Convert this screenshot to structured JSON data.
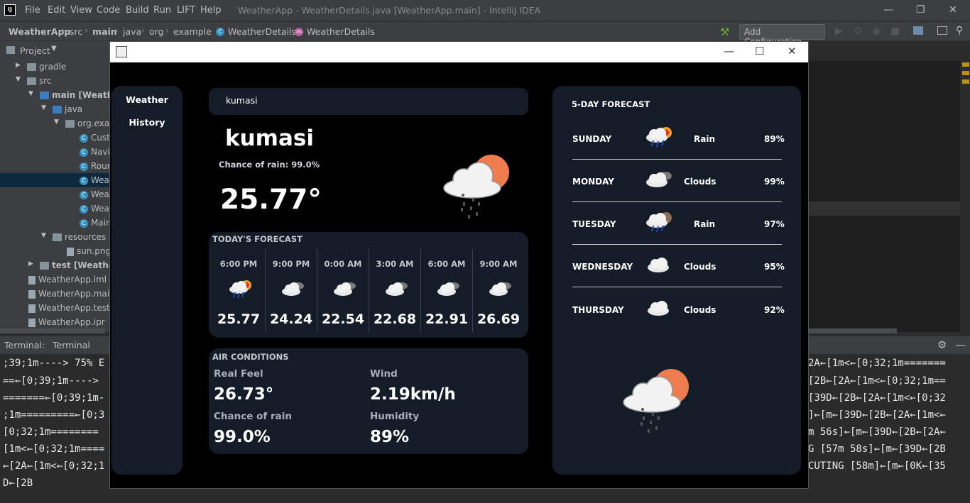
{
  "ide": {
    "logo": "IJ",
    "menu": [
      "File",
      "Edit",
      "View",
      "Code",
      "Build",
      "Run",
      "LIFT",
      "Help"
    ],
    "title": "WeatherApp - WeatherDetails.java [WeatherApp.main] - IntelliJ IDEA",
    "breadcrumbs": [
      "WeatherApp",
      "src",
      "main",
      "java",
      "org",
      "example",
      "WeatherDetails",
      "WeatherDetails"
    ],
    "add_configuration": "Add Configuration...",
    "project_label": "Project",
    "tree": [
      {
        "label": "gradle",
        "icon": "folder-icon"
      },
      {
        "label": "src",
        "icon": "folder-icon"
      },
      {
        "label": "main [Weathe",
        "icon": "folder-icon"
      },
      {
        "label": "java",
        "icon": "folder-icon"
      },
      {
        "label": "org.exan",
        "icon": "package-icon"
      },
      {
        "label": "Cust",
        "icon": "class-icon"
      },
      {
        "label": "Navi",
        "icon": "class-icon"
      },
      {
        "label": "Roun",
        "icon": "class-icon"
      },
      {
        "label": "Weat",
        "icon": "class-icon"
      },
      {
        "label": "Weat",
        "icon": "class-icon"
      },
      {
        "label": "Weat",
        "icon": "class-icon"
      },
      {
        "label": "Main",
        "icon": "class-icon"
      },
      {
        "label": "resources",
        "icon": "folder-icon"
      },
      {
        "label": "sun.png",
        "icon": "image-file-icon"
      },
      {
        "label": "test [Weather/",
        "icon": "folder-icon"
      },
      {
        "label": "WeatherApp.iml",
        "icon": "file-icon"
      },
      {
        "label": "WeatherApp.main",
        "icon": "file-icon"
      },
      {
        "label": "WeatherApp.test.ir",
        "icon": "file-icon"
      },
      {
        "label": "WeatherApp.ipr",
        "icon": "file-icon"
      }
    ],
    "terminal_label": "Terminal:",
    "terminal_tab": "Terminal",
    "terminal_left": [
      ";39;1m----> 75% E",
      "==←[0;39;1m---->",
      "=======←[0;39;1m-",
      ";1m=========←[0;3",
      "[0;32;1m========",
      "[1m<←[0;32;1m====",
      "←[2A←[1m<←[0;32;1",
      "D←[2B"
    ],
    "terminal_right": [
      "2A←[1m<←[0;32;1m=======",
      "[2B←[2A←[1m<←[0;32;1m==",
      "[39D←[2B←[2A←[1m<←[0;32",
      "]←[m←[39D←[2B←[2A←[1m<←",
      "m 56s]←[m←[39D←[2B←[2A←",
      "G [57m 58s]←[m←[39D←[2B",
      "CUTING [58m]←[m←[0K←[35",
      ""
    ]
  },
  "app": {
    "nav": {
      "weather": "Weather",
      "history": "History"
    },
    "search": {
      "value": "kumasi"
    },
    "current": {
      "city": "kumasi",
      "chance_of_rain": "Chance of rain: 99.0%",
      "temperature": "25.77°",
      "icon": "rain-cloud-sun-icon"
    },
    "today": {
      "title": "TODAY'S FORECAST",
      "hours": [
        {
          "time": "6:00 PM",
          "temp": "25.77",
          "icon": "rain-sun-icon"
        },
        {
          "time": "9:00 PM",
          "temp": "24.24",
          "icon": "cloud-icon"
        },
        {
          "time": "0:00 AM",
          "temp": "22.54",
          "icon": "cloud-icon"
        },
        {
          "time": "3:00 AM",
          "temp": "22.68",
          "icon": "cloud-icon"
        },
        {
          "time": "6:00 AM",
          "temp": "22.91",
          "icon": "cloud-icon"
        },
        {
          "time": "9:00 AM",
          "temp": "26.69",
          "icon": "cloud-icon"
        }
      ]
    },
    "air": {
      "title": "AIR CONDITIONS",
      "real_feel_label": "Real Feel",
      "real_feel": "26.73°",
      "wind_label": "Wind",
      "wind": "2.19km/h",
      "chance_label": "Chance of rain",
      "chance": "99.0%",
      "humidity_label": "Humidity",
      "humidity": "89%"
    },
    "forecast": {
      "title": "5-DAY FORECAST",
      "days": [
        {
          "day": "SUNDAY",
          "condition": "Rain",
          "pct": "89%",
          "icon": "rain-sun-icon"
        },
        {
          "day": "MONDAY",
          "condition": "Clouds",
          "pct": "99%",
          "icon": "cloud-icon"
        },
        {
          "day": "TUESDAY",
          "condition": "Rain",
          "pct": "97%",
          "icon": "rain-moon-icon"
        },
        {
          "day": "WEDNESDAY",
          "condition": "Clouds",
          "pct": "95%",
          "icon": "cloud-icon"
        },
        {
          "day": "THURSDAY",
          "condition": "Clouds",
          "pct": "92%",
          "icon": "cloud-icon"
        }
      ]
    },
    "colors": {
      "panel": "#141c27",
      "background": "#000000",
      "sun": "#ef7c4e"
    }
  }
}
